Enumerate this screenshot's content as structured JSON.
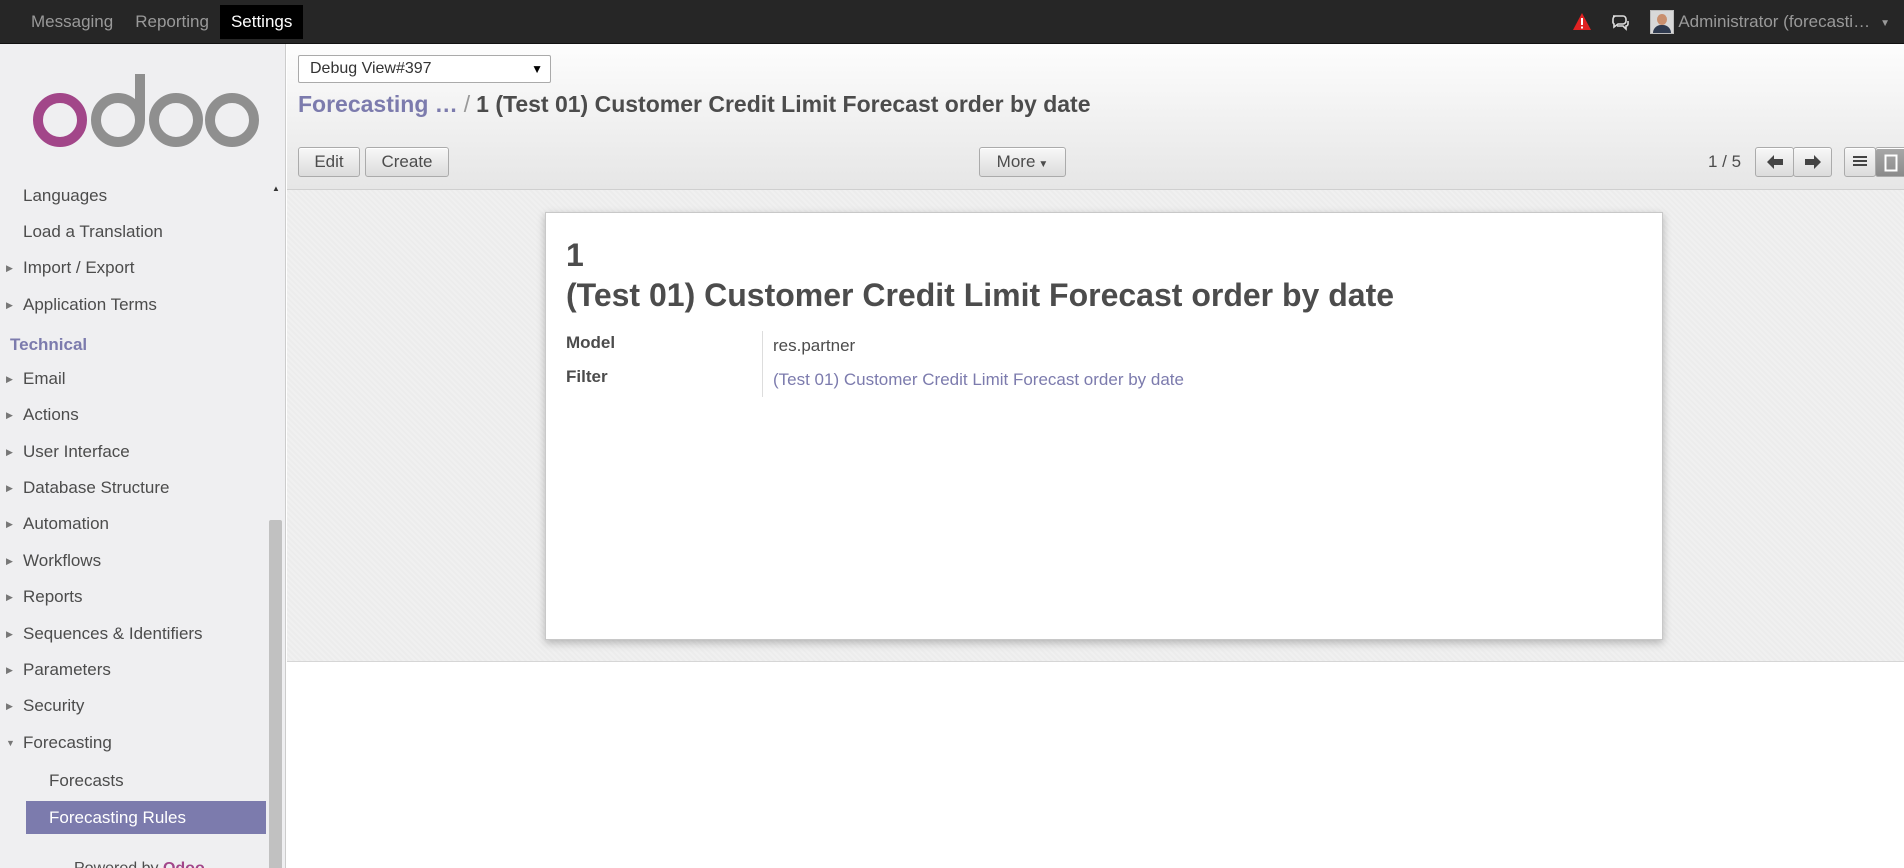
{
  "topbar": {
    "menu": [
      "Messaging",
      "Reporting",
      "Settings"
    ],
    "active": "Settings",
    "user_name": "Administrator (forecasti…",
    "alert_color": "#e02222"
  },
  "sidebar": {
    "items": [
      {
        "label": "Languages"
      },
      {
        "label": "Load a Translation"
      },
      {
        "label": "Import / Export"
      },
      {
        "label": "Application Terms"
      },
      {
        "label": "Email"
      },
      {
        "label": "Actions"
      },
      {
        "label": "User Interface"
      },
      {
        "label": "Database Structure"
      },
      {
        "label": "Automation"
      },
      {
        "label": "Workflows"
      },
      {
        "label": "Reports"
      },
      {
        "label": "Sequences & Identifiers"
      },
      {
        "label": "Parameters"
      },
      {
        "label": "Security"
      },
      {
        "label": "Forecasting"
      },
      {
        "label": "Forecasts"
      },
      {
        "label": "Forecasting Rules"
      }
    ],
    "section_technical": "Technical",
    "powered_by": "Powered by",
    "powered_brand": "Odoo"
  },
  "control": {
    "debug_select": "Debug View#397",
    "breadcrumb_parent": "Forecasting …",
    "breadcrumb_separator": "/",
    "breadcrumb_current": "1 (Test 01) Customer Credit Limit Forecast order by date",
    "edit_label": "Edit",
    "create_label": "Create",
    "more_label": "More",
    "pager": "1 / 5"
  },
  "record": {
    "sequence": "1",
    "title": "(Test 01) Customer Credit Limit Forecast order by date",
    "fields": [
      {
        "label": "Model",
        "value": "res.partner"
      },
      {
        "label": "Filter",
        "value": "(Test 01) Customer Credit Limit Forecast order by date"
      }
    ]
  },
  "colors": {
    "brand": "#7c7bad",
    "logo_o": "#a24689",
    "logo_grey": "#8f8f8f"
  }
}
